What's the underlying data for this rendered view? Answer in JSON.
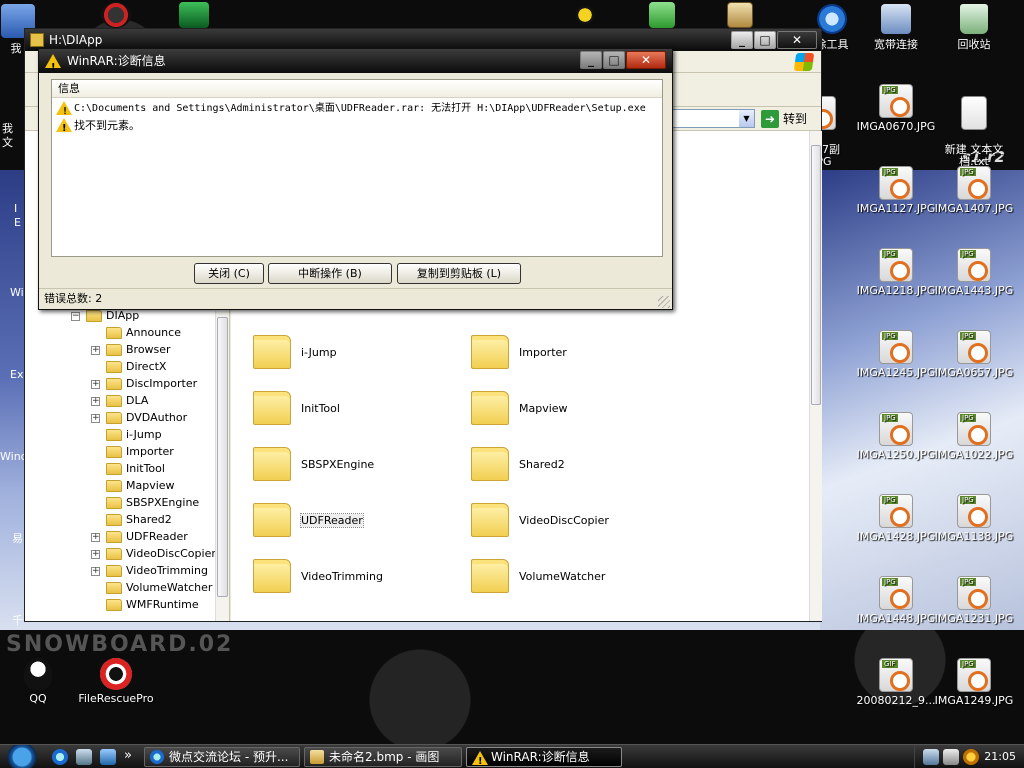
{
  "desktop": {
    "top_icons": [
      {
        "label": "我",
        "icon": "my-documents-icon"
      },
      {
        "label": "",
        "icon": "nero-icon"
      },
      {
        "label": "",
        "icon": "eye-app-icon"
      },
      {
        "label": "",
        "icon": "bee-app-icon"
      },
      {
        "label": "",
        "icon": "add-app-icon"
      },
      {
        "label": "",
        "icon": "r-app-icon"
      },
      {
        "label": "除工具",
        "icon": "ie-like-app-icon"
      },
      {
        "label": "宽带连接",
        "icon": "broadband-connection-icon"
      },
      {
        "label": "回收站",
        "icon": "recycle-bin-icon"
      }
    ],
    "left_edge_labels": [
      "我",
      "文",
      "I",
      "E",
      "Wi",
      "Ex",
      "Wind",
      "易",
      "千"
    ],
    "file_icons": [
      {
        "label": "407副\nPG",
        "type": "JPG"
      },
      {
        "label": "IMGA0670.JPG",
        "type": "JPG"
      },
      {
        "label": "新建 文本文\n档.txt",
        "type": "TXT"
      },
      {
        "label": "IMGA1127.JPG",
        "type": "JPG"
      },
      {
        "label": "IMGA1407.JPG",
        "type": "JPG"
      },
      {
        "label": "IMGA1218.JPG",
        "type": "JPG"
      },
      {
        "label": "IMGA1443.JPG",
        "type": "JPG"
      },
      {
        "label": "IMGA1245.JPG",
        "type": "JPG"
      },
      {
        "label": "IMGA0657.JPG",
        "type": "JPG"
      },
      {
        "label": "IMGA1250.JPG",
        "type": "JPG"
      },
      {
        "label": "IMGA1022.JPG",
        "type": "JPG"
      },
      {
        "label": "IMGA1428.JPG",
        "type": "JPG"
      },
      {
        "label": "IMGA1138.JPG",
        "type": "JPG"
      },
      {
        "label": "IMGA1448.JPG",
        "type": "JPG"
      },
      {
        "label": "IMGA1231.JPG",
        "type": "JPG"
      },
      {
        "label": "20080212_9...",
        "type": "GIF"
      },
      {
        "label": "IMGA1249.JPG",
        "type": "JPG"
      },
      {
        "label": "QQ",
        "type": "APP"
      },
      {
        "label": "FileRescuePro",
        "type": "APP"
      }
    ],
    "wallpaper_text": "SNOWBOARD.02",
    "wallpaper_brand": "s1.r2"
  },
  "explorer": {
    "title": "H:\\DIApp",
    "go_label": "转到",
    "tree": [
      {
        "label": "DIApp",
        "expand": "−"
      },
      {
        "label": "Announce",
        "expand": ""
      },
      {
        "label": "Browser",
        "expand": "+"
      },
      {
        "label": "DirectX",
        "expand": ""
      },
      {
        "label": "DiscImporter",
        "expand": "+"
      },
      {
        "label": "DLA",
        "expand": "+"
      },
      {
        "label": "DVDAuthor",
        "expand": "+"
      },
      {
        "label": "i-Jump",
        "expand": ""
      },
      {
        "label": "Importer",
        "expand": ""
      },
      {
        "label": "InitTool",
        "expand": ""
      },
      {
        "label": "Mapview",
        "expand": ""
      },
      {
        "label": "SBSPXEngine",
        "expand": ""
      },
      {
        "label": "Shared2",
        "expand": ""
      },
      {
        "label": "UDFReader",
        "expand": "+"
      },
      {
        "label": "VideoDiscCopier",
        "expand": "+"
      },
      {
        "label": "VideoTrimming",
        "expand": "+"
      },
      {
        "label": "VolumeWatcher",
        "expand": ""
      },
      {
        "label": "WMFRuntime",
        "expand": ""
      }
    ],
    "files": [
      {
        "label": "i-Jump"
      },
      {
        "label": "Importer"
      },
      {
        "label": "InitTool"
      },
      {
        "label": "Mapview"
      },
      {
        "label": "SBSPXEngine"
      },
      {
        "label": "Shared2"
      },
      {
        "label": "UDFReader"
      },
      {
        "label": "VideoDiscCopier"
      },
      {
        "label": "VideoTrimming"
      },
      {
        "label": "VolumeWatcher"
      }
    ]
  },
  "dialog": {
    "title": "WinRAR:诊断信息",
    "column_header": "信息",
    "messages": [
      "C:\\Documents and Settings\\Administrator\\桌面\\UDFReader.rar: 无法打开 H:\\DIApp\\UDFReader\\Setup.exe",
      "找不到元素。"
    ],
    "buttons": {
      "close": "关闭 (C)",
      "abort": "中断操作 (B)",
      "copy": "复制到剪贴板 (L)"
    },
    "error_count_label": "错误总数:",
    "error_count": "2"
  },
  "taskbar": {
    "tasks": [
      {
        "label": "微点交流论坛 - 预升...",
        "icon": "ie-icon"
      },
      {
        "label": "未命名2.bmp - 画图",
        "icon": "paint-icon"
      },
      {
        "label": "WinRAR:诊断信息",
        "icon": "warning-icon"
      }
    ],
    "overflow": "»",
    "clock": "21:05"
  }
}
